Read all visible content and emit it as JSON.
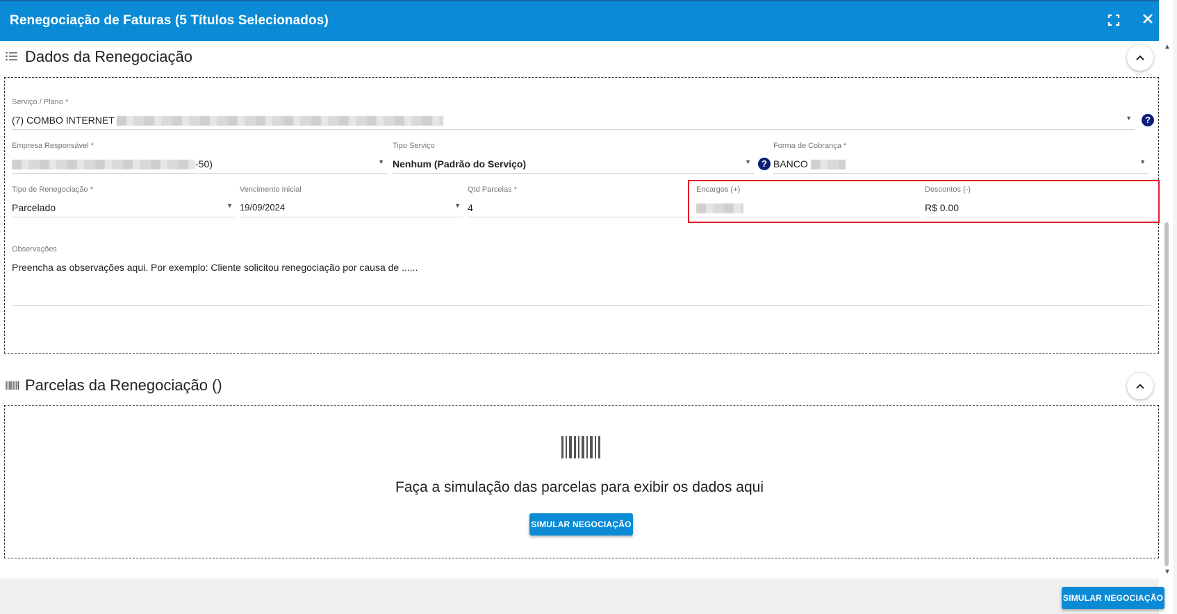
{
  "dialog": {
    "title": "Renegociação de Faturas (5 Títulos Selecionados)"
  },
  "section1": {
    "title": "Dados da Renegociação",
    "fields": {
      "servico": {
        "label": "Serviço / Plano *",
        "value": "(7) COMBO INTERNET"
      },
      "empresa": {
        "label": "Empresa Responsável *",
        "value_suffix": "-50)"
      },
      "tipo_servico": {
        "label": "Tipo Serviço",
        "value": "Nenhum (Padrão do Serviço)"
      },
      "forma_cobranca": {
        "label": "Forma de Cobrança *",
        "value": "BANCO"
      },
      "tipo_renegociacao": {
        "label": "Tipo de Renegociação *",
        "value": "Parcelado"
      },
      "vencimento": {
        "label": "Vencimento Inicial",
        "value": "19/09/2024"
      },
      "qtd_parcelas": {
        "label": "Qtd Parcelas *",
        "value": "4"
      },
      "encargos": {
        "label": "Encargos (+)"
      },
      "descontos": {
        "label": "Descontos (-)",
        "value": "R$ 0.00"
      },
      "observacoes": {
        "label": "Observações",
        "placeholder": "Preencha as observações aqui. Por exemplo: Cliente solicitou renegociação por causa de ......"
      }
    },
    "help_glyph": "?"
  },
  "section2": {
    "title": "Parcelas da Renegociação ()",
    "empty_message": "Faça a simulação das parcelas para exibir os dados aqui",
    "simulate_label": "SIMULAR NEGOCIAÇÃO"
  },
  "footer": {
    "simulate_label": "SIMULAR NEGOCIAÇÃO"
  },
  "colors": {
    "header": "#0b8bd5",
    "button": "#0b8bd5",
    "highlight": "#e41e26",
    "help": "#0b1e7a"
  }
}
